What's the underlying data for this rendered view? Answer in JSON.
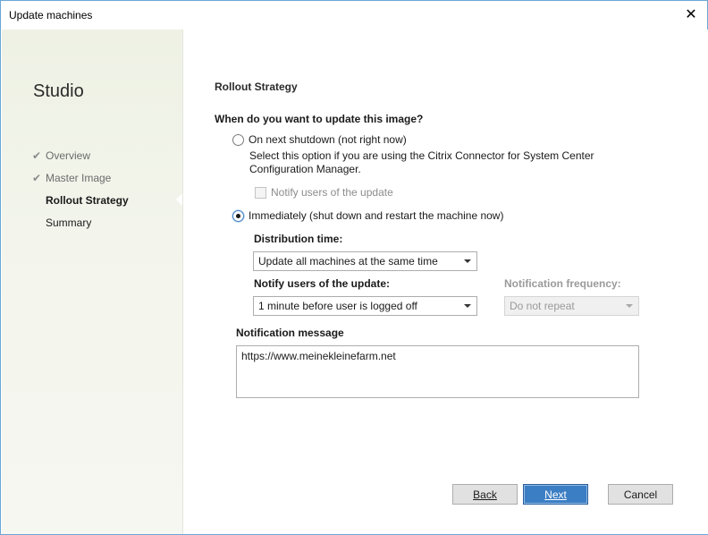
{
  "window": {
    "title": "Update machines",
    "close_glyph": "✕"
  },
  "sidebar": {
    "app_title": "Studio",
    "steps": [
      {
        "label": "Overview",
        "state": "done",
        "check": "✔"
      },
      {
        "label": "Master Image",
        "state": "done",
        "check": "✔"
      },
      {
        "label": "Rollout Strategy",
        "state": "active"
      },
      {
        "label": "Summary",
        "state": "pending"
      }
    ]
  },
  "main": {
    "section_title": "Rollout Strategy",
    "question": "When do you want to update this image?",
    "option_next_shutdown": {
      "label": "On next shutdown (not right now)",
      "selected": false,
      "description": "Select this option if you are using the Citrix Connector for System Center Configuration Manager.",
      "notify_checkbox_label": "Notify users of the update",
      "notify_checked": false
    },
    "option_immediately": {
      "label": "Immediately (shut down and restart the machine now)",
      "selected": true
    },
    "distribution_time": {
      "label": "Distribution time:",
      "value": "Update all machines at the same time"
    },
    "notify_users": {
      "label": "Notify users of the update:",
      "value": "1 minute before user is logged off"
    },
    "notification_frequency": {
      "label": "Notification frequency:",
      "value": "Do not repeat"
    },
    "notification_message": {
      "label": "Notification message",
      "value": "https://www.meinekleinefarm.net"
    }
  },
  "buttons": {
    "back": "Back",
    "next": "Next",
    "cancel": "Cancel"
  },
  "colors": {
    "accent": "#3c7ec4",
    "window_border": "#6aa6d6",
    "sidebar_bg": "#eef1e4"
  }
}
